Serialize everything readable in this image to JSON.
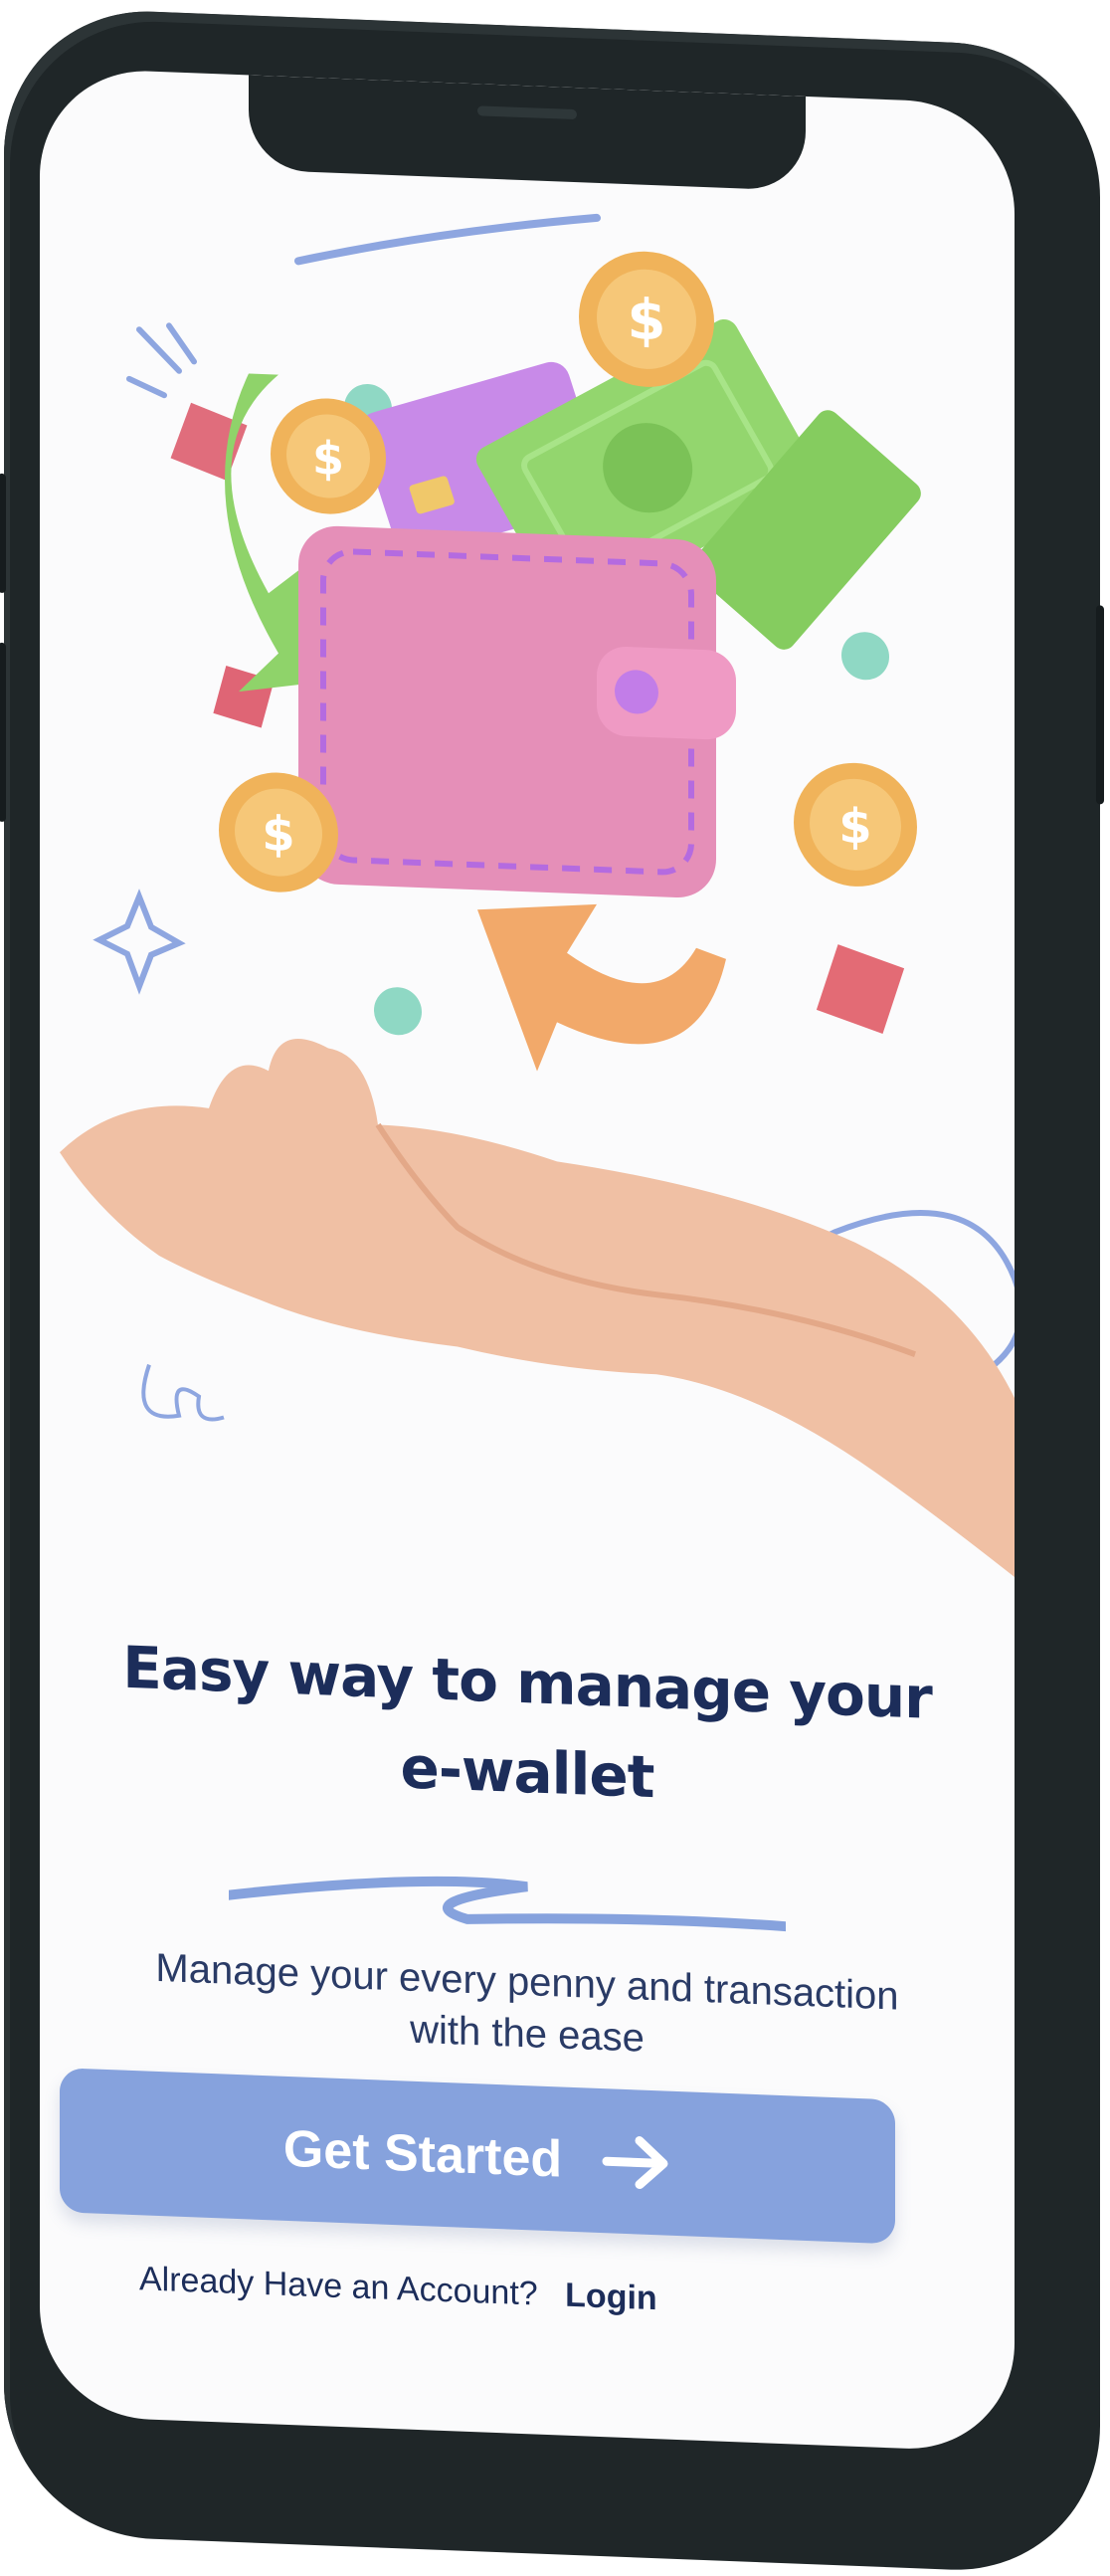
{
  "onboarding": {
    "headline_line1": "Easy way to manage  your",
    "headline_line2": "e-wallet",
    "subtitle_line1": "Manage your every penny and  transaction",
    "subtitle_line2": "with the ease",
    "cta_label": "Get Started",
    "account_prompt": "Already Have an Account?",
    "login_label": "Login"
  },
  "icons": {
    "wallet": "wallet-icon",
    "coin": "dollar-coin-icon",
    "cash": "banknote-icon",
    "card": "credit-card-icon",
    "hand": "open-hand-icon",
    "arrow": "arrow-right-icon"
  },
  "colors": {
    "primary": "#86a2dd",
    "heading": "#1c2d5a",
    "wallet_pink": "#e58fb8",
    "cash_green": "#8fd36a",
    "coin_gold": "#f0b35a"
  }
}
